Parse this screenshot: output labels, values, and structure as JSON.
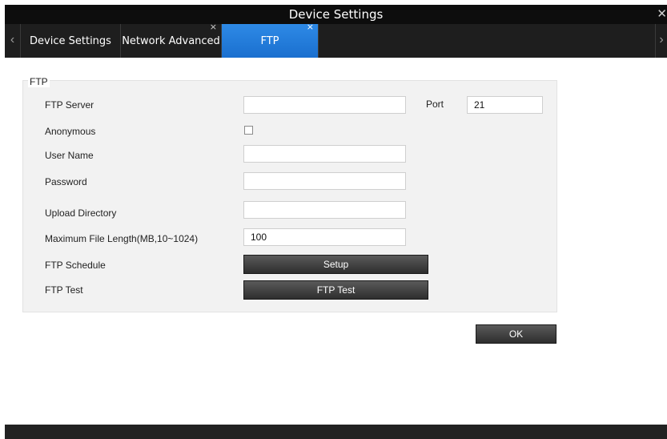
{
  "window": {
    "title": "Device Settings",
    "close_glyph": "✕"
  },
  "tabs": [
    {
      "label": "Device Settings",
      "closable": false
    },
    {
      "label": "Network Advanced",
      "closable": true,
      "close_glyph": "×"
    },
    {
      "label": "FTP",
      "closable": true,
      "close_glyph": "×",
      "active": true
    }
  ],
  "nav": {
    "left_glyph": "‹",
    "right_glyph": "›"
  },
  "ftp": {
    "group_title": "FTP",
    "server_label": "FTP Server",
    "server_value": "",
    "port_label": "Port",
    "port_value": "21",
    "anonymous_label": "Anonymous",
    "anonymous_checked": false,
    "username_label": "User Name",
    "username_value": "",
    "password_label": "Password",
    "password_value": "",
    "upload_dir_label": "Upload Directory",
    "upload_dir_value": "",
    "max_len_label": "Maximum File Length(MB,10~1024)",
    "max_len_value": "100",
    "schedule_label": "FTP Schedule",
    "schedule_button": "Setup",
    "test_label": "FTP Test",
    "test_button": "FTP Test"
  },
  "actions": {
    "ok_label": "OK"
  },
  "colors": {
    "accent": "#1f7ad8",
    "titlebar": "#0d0d0d",
    "tabbar": "#1e1e1e",
    "panel": "#f2f2f2"
  }
}
